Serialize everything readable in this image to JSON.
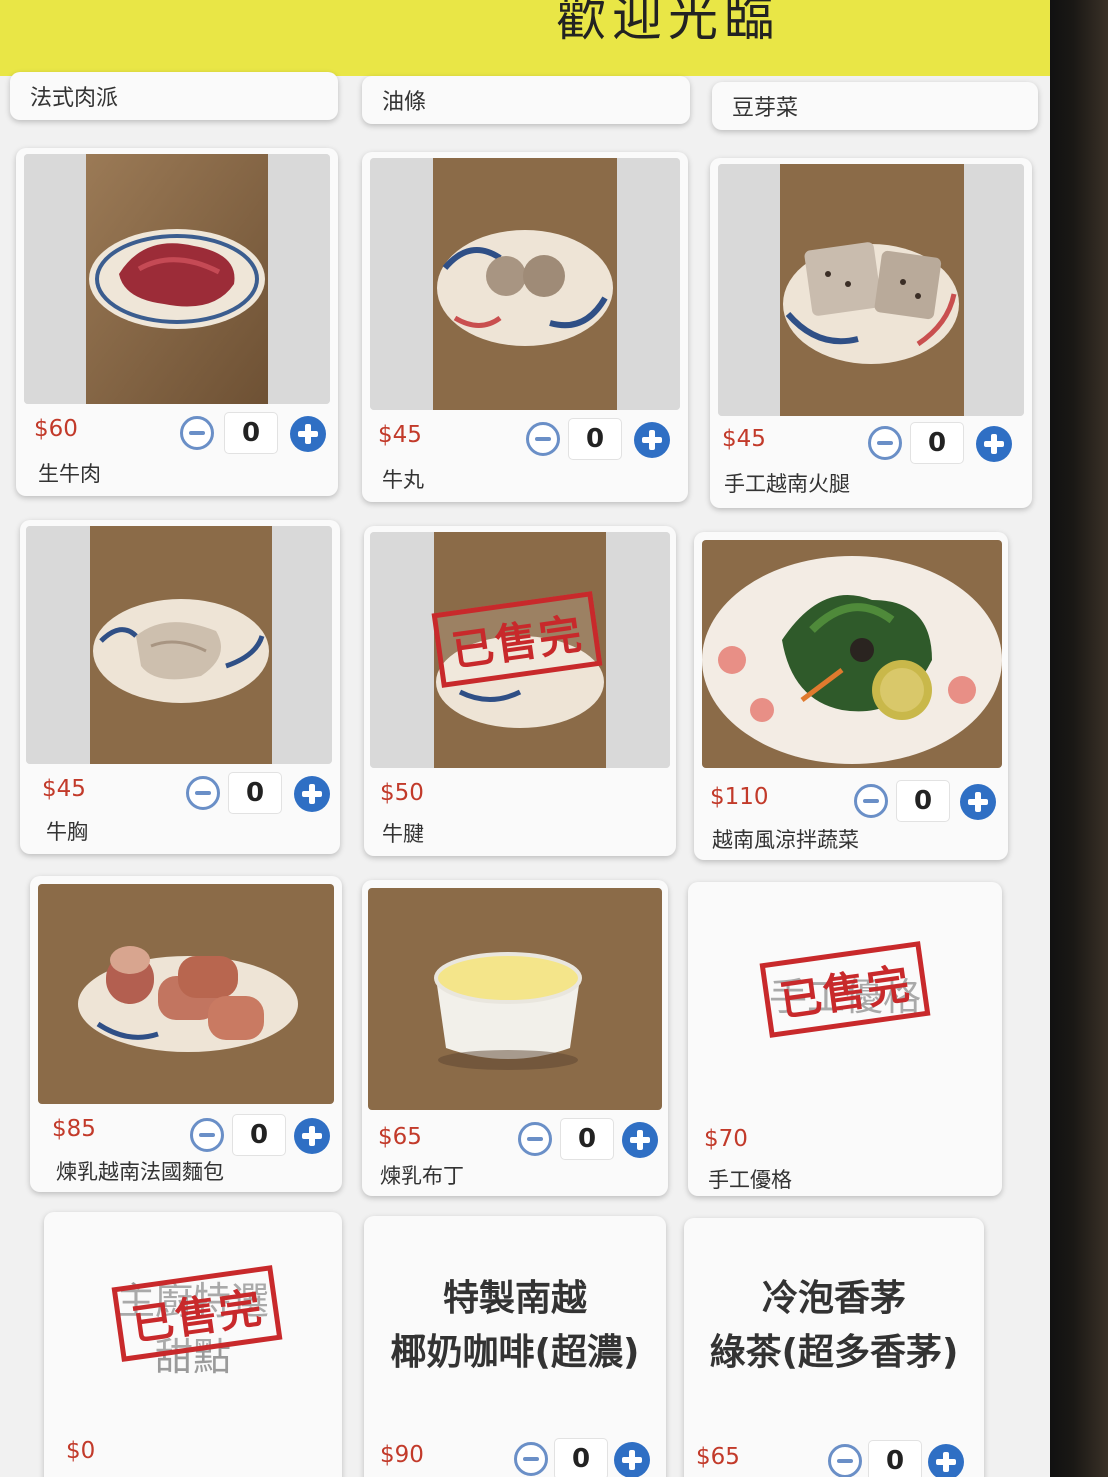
{
  "header": {
    "title": "歡迎光臨",
    "bg_color": "#e9e646"
  },
  "categories": [
    {
      "label": "法式肉派"
    },
    {
      "label": "油條"
    },
    {
      "label": "豆芽菜"
    }
  ],
  "items": [
    {
      "name": "生牛肉",
      "price": "$60",
      "qty": "0",
      "image": "raw-beef-plate"
    },
    {
      "name": "牛丸",
      "price": "$45",
      "qty": "0",
      "image": "beef-balls-plate"
    },
    {
      "name": "手工越南火腿",
      "price": "$45",
      "qty": "0",
      "image": "vietnamese-ham-plate"
    },
    {
      "name": "牛胸",
      "price": "$45",
      "qty": "0",
      "image": "beef-brisket-plate"
    },
    {
      "name": "牛腱",
      "price": "$50",
      "image": "beef-shank-plate",
      "sold_out_label": "已售完"
    },
    {
      "name": "越南風涼拌蔬菜",
      "price": "$110",
      "qty": "0",
      "image": "vietnamese-salad-plate"
    },
    {
      "name": "煉乳越南法國麵包",
      "price": "$85",
      "qty": "0",
      "image": "condensed-milk-baguette-plate"
    },
    {
      "name": "煉乳布丁",
      "price": "$65",
      "qty": "0",
      "image": "condensed-milk-pudding"
    },
    {
      "name": "手工優格",
      "price": "$70",
      "sold_out_label": "已售完",
      "ghost_text": "手工優格"
    },
    {
      "price": "$0",
      "sold_out_label": "已售完",
      "ghost_text_line1": "主廚特選",
      "ghost_text_line2": "甜點"
    },
    {
      "title_line1": "特製南越",
      "title_line2": "椰奶咖啡(超濃)",
      "price": "$90",
      "qty": "0"
    },
    {
      "title_line1": "冷泡香茅",
      "title_line2": "綠茶(超多香茅)",
      "price": "$65",
      "qty": "0"
    }
  ],
  "colors": {
    "price": "#c23a2a",
    "plus_button": "#2f6fc4",
    "minus_button": "#6a8fc7",
    "stamp": "#c8292b"
  }
}
